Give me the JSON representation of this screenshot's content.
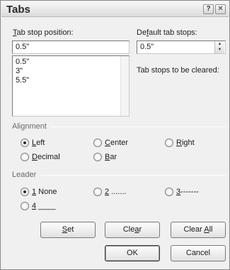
{
  "dialog": {
    "title": "Tabs",
    "help_glyph": "?",
    "close_glyph": "✕"
  },
  "tab_stop": {
    "label_prefix": "",
    "label_hotkey": "T",
    "label_rest": "ab stop position:",
    "value": "0.5\"",
    "list": [
      "0.5\"",
      "3\"",
      "5.5\""
    ]
  },
  "default_tabs": {
    "label_prefix": "De",
    "label_hotkey": "f",
    "label_rest": "ault tab stops:",
    "value": "0.5\"",
    "spin_up": "▲",
    "spin_down": "▼"
  },
  "clear_note": "Tab stops to be cleared:",
  "alignment": {
    "label": "Alignment",
    "options": [
      {
        "hk": "L",
        "rest": "eft",
        "selected": true
      },
      {
        "hk": "C",
        "rest": "enter",
        "selected": false
      },
      {
        "hk": "R",
        "rest": "ight",
        "selected": false
      },
      {
        "hk": "D",
        "rest": "ecimal",
        "selected": false
      },
      {
        "hk": "B",
        "rest": "ar",
        "selected": false
      }
    ]
  },
  "leader": {
    "label": "Leader",
    "options": [
      {
        "hk": "1",
        "rest": " None",
        "selected": true
      },
      {
        "hk": "2",
        "rest": " .......",
        "selected": false
      },
      {
        "hk": "3",
        "rest": "-------",
        "selected": false
      },
      {
        "hk": "4",
        "rest": " ____",
        "selected": false
      }
    ]
  },
  "buttons": {
    "set_hk": "S",
    "set_rest": "et",
    "clear_pre": "Cle",
    "clear_hk": "a",
    "clear_rest": "r",
    "clear_all_pre": "Clear ",
    "clear_all_hk": "A",
    "clear_all_rest": "ll",
    "ok": "OK",
    "cancel": "Cancel"
  }
}
